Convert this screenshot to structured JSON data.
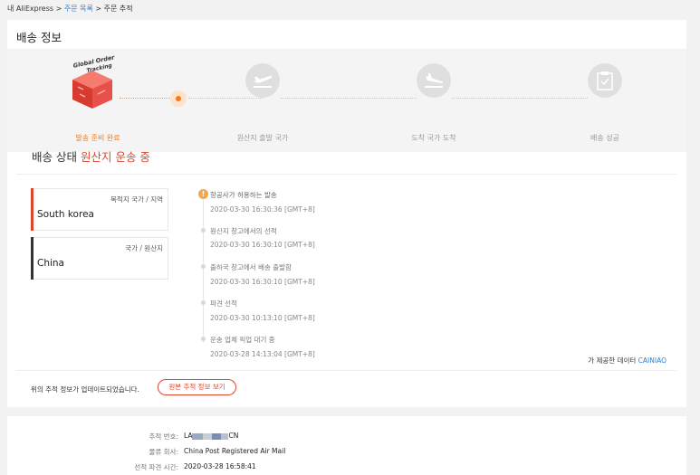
{
  "breadcrumb": {
    "home": "내 AliExpress",
    "sep1": " > ",
    "orders": "주문 목록",
    "sep2": " > ",
    "current": "주문 추적"
  },
  "page_title": "배송 정보",
  "steps": [
    {
      "label": "발송 준비 완료",
      "badge": "Global Order Tracking",
      "active": true
    },
    {
      "label": "원산지 출발 국가",
      "icon": "plane-takeoff-icon"
    },
    {
      "label": "도착 국가 도착",
      "icon": "plane-landing-icon"
    },
    {
      "label": "배송 성공",
      "icon": "clipboard-check-icon"
    }
  ],
  "status": {
    "prefix": "배송 상태",
    "value": "원산지 운송 중"
  },
  "destination": {
    "caption": "목적지 국가 / 지역",
    "value": "South korea"
  },
  "origin": {
    "caption": "국가 / 원산지",
    "value": "China"
  },
  "events": [
    {
      "title": "항공사가 허용하는 발송",
      "time": "2020-03-30 16:30:36 [GMT+8]"
    },
    {
      "title": "원산지 창고에서의 선적",
      "time": "2020-03-30 16:30:10 [GMT+8]"
    },
    {
      "title": "출하국 창고에서 배송 출발함",
      "time": "2020-03-30 16:30:10 [GMT+8]"
    },
    {
      "title": "파견 선적",
      "time": "2020-03-30 10:13:10 [GMT+8]"
    },
    {
      "title": "운송 업체 픽업 대기 중",
      "time": "2020-03-28 14:13:04 [GMT+8]"
    }
  ],
  "provider": {
    "text": "가 제공한 데이터",
    "name": "CAINIAO"
  },
  "update_note": "위의 추적 정보가 업데이트되었습니다.",
  "view_original": "원본 추적 정보 보기",
  "details": {
    "tracking_label": "추적 번호:",
    "tracking_prefix": "LA",
    "tracking_suffix": "CN",
    "carrier_label": "물류 회사:",
    "carrier": "China Post Registered Air Mail",
    "shipped_label": "선적 파견 시간:",
    "shipped": "2020-03-28 16:58:41"
  },
  "colors": {
    "accent": "#f37b1d",
    "highlight": "#e0452c",
    "link": "#2980d9",
    "box_bar_dest": "#e0452c",
    "box_bar_origin": "#333333"
  }
}
